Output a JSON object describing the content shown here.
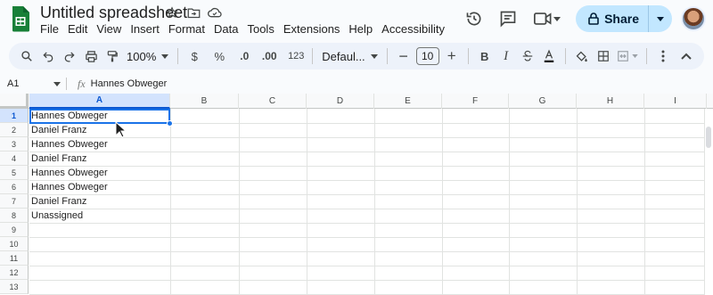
{
  "title": "Untitled spreadsheet",
  "menus": [
    "File",
    "Edit",
    "View",
    "Insert",
    "Format",
    "Data",
    "Tools",
    "Extensions",
    "Help",
    "Accessibility"
  ],
  "share_label": "Share",
  "toolbar": {
    "zoom": "100%",
    "currency": "$",
    "percent": "%",
    "dec_decrease": ".0",
    "dec_increase": ".00",
    "number_format": "123",
    "font": "Defaul...",
    "font_size": "10",
    "bold": "B",
    "italic": "I",
    "minus": "−",
    "plus": "+"
  },
  "formula_bar": {
    "cell_ref": "A1",
    "fx": "fx",
    "value": "Hannes Obweger"
  },
  "columns": [
    "A",
    "B",
    "C",
    "D",
    "E",
    "F",
    "G",
    "H",
    "I"
  ],
  "selected_column": "A",
  "rows": [
    "1",
    "2",
    "3",
    "4",
    "5",
    "6",
    "7",
    "8",
    "9",
    "10",
    "11",
    "12",
    "13"
  ],
  "cells_A": [
    "Hannes Obweger",
    "Daniel Franz",
    "Hannes Obweger",
    "Daniel Franz",
    "Hannes Obweger",
    "Hannes Obweger",
    "Daniel Franz",
    "Unassigned"
  ],
  "colors": {
    "accent": "#1a73e8",
    "share_bg": "#c2e7ff",
    "toolbar_bg": "#edf2fa",
    "selected_header": "#d3e3fd"
  }
}
